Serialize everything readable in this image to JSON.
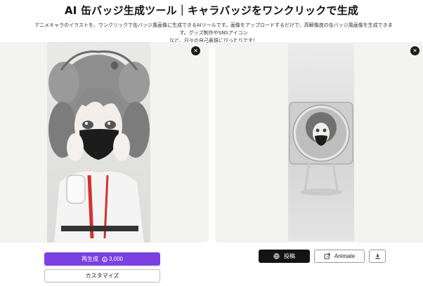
{
  "header": {
    "title": "AI 缶バッジ生成ツール｜キャラバッジをワンクリックで生成",
    "description_line1": "アニメキャラのイラストを、ワンクリックで缶バッジ風画像に生成できるAIツールです。画像をアップロードするだけで、高解像度の缶バッジ風画像を生成できます。グッズ制作やSNSアイコン",
    "description_line2": "など、日々の自己表現にぴったりです！"
  },
  "actions": {
    "regenerate_label": "再生成",
    "regenerate_cost": "3,000",
    "customize_label": "カスタマイズ",
    "post_label": "投稿",
    "animate_label": "Animate"
  },
  "colors": {
    "primary": "#7b3fe4",
    "dark_button": "#141414",
    "panel_bg": "#f3f3f1"
  },
  "icons": {
    "close": "close-icon",
    "coin": "coin-icon",
    "globe": "globe-icon",
    "animate": "animate-icon",
    "download": "download-icon"
  }
}
